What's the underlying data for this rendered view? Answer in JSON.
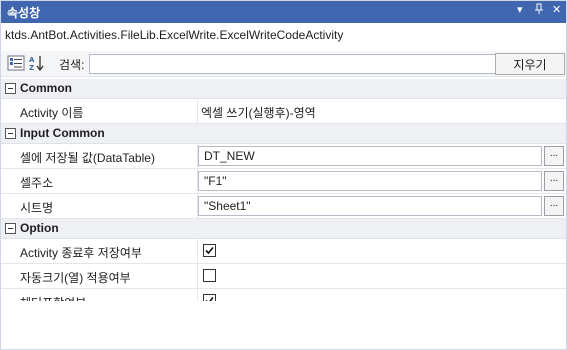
{
  "titlebar": {
    "title": "속성창",
    "controls": [
      "▾",
      "ᵖ",
      "✕"
    ]
  },
  "subject": "ktds.AntBot.Activities.FileLib.ExcelWrite.ExcelWriteCodeActivity",
  "toolbar": {
    "search_label": "검색:",
    "search_value": "",
    "clear_label": "지우기"
  },
  "categories": [
    {
      "name": "Common",
      "rows": [
        {
          "label": "Activity 이름",
          "value": "엑셀 쓰기(실행후)-영역"
        }
      ]
    },
    {
      "name": "Input Common",
      "rows": [
        {
          "label": "셀에 저장될 값(DataTable)",
          "value": "DT_NEW"
        },
        {
          "label": "셀주소",
          "value": "\"F1\""
        },
        {
          "label": "시트명",
          "value": "\"Sheet1\""
        }
      ]
    },
    {
      "name": "Option",
      "rows": [
        {
          "label": "Activity 종료후 저장여부",
          "checked": true
        },
        {
          "label": "자동크기(열) 적용여부",
          "checked": false
        },
        {
          "label": "헤더포함여부",
          "checked": true
        }
      ]
    }
  ],
  "ellipsis_label": "...",
  "colors": {
    "titlebar": "#3f66ae",
    "category_bg": "#eef0f4"
  }
}
